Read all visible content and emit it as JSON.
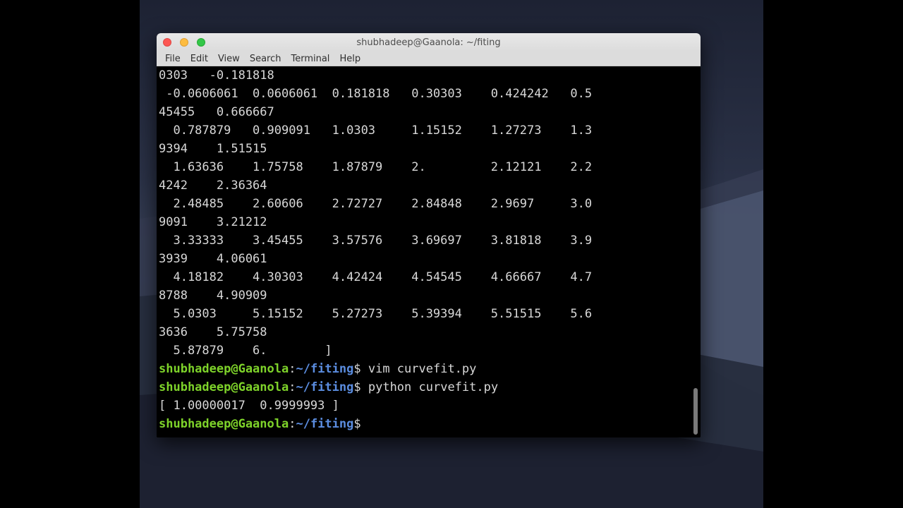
{
  "window": {
    "title": "shubhadeep@Gaanola: ~/fiting"
  },
  "menubar": {
    "items": [
      "File",
      "Edit",
      "View",
      "Search",
      "Terminal",
      "Help"
    ]
  },
  "terminal": {
    "output_lines": [
      "0303   -0.181818",
      " -0.0606061  0.0606061  0.181818   0.30303    0.424242   0.5",
      "45455   0.666667",
      "  0.787879   0.909091   1.0303     1.15152    1.27273    1.3",
      "9394    1.51515",
      "  1.63636    1.75758    1.87879    2.         2.12121    2.2",
      "4242    2.36364",
      "  2.48485    2.60606    2.72727    2.84848    2.9697     3.0",
      "9091    3.21212",
      "  3.33333    3.45455    3.57576    3.69697    3.81818    3.9",
      "3939    4.06061",
      "  4.18182    4.30303    4.42424    4.54545    4.66667    4.7",
      "8788    4.90909",
      "  5.0303     5.15152    5.27273    5.39394    5.51515    5.6",
      "3636    5.75758",
      "  5.87879    6.        ]"
    ],
    "prompt": {
      "user_host": "shubhadeep@Gaanola",
      "separator": ":",
      "path": "~/fiting",
      "symbol": "$"
    },
    "commands": [
      {
        "command": " vim curvefit.py"
      },
      {
        "command": " python curvefit.py"
      }
    ],
    "result_line": "[ 1.00000017  0.9999993 ]",
    "current_input": " "
  },
  "colors": {
    "prompt_user": "#7ed32a",
    "prompt_path": "#5b8de0",
    "text": "#d8d8d8",
    "background": "#000000"
  }
}
